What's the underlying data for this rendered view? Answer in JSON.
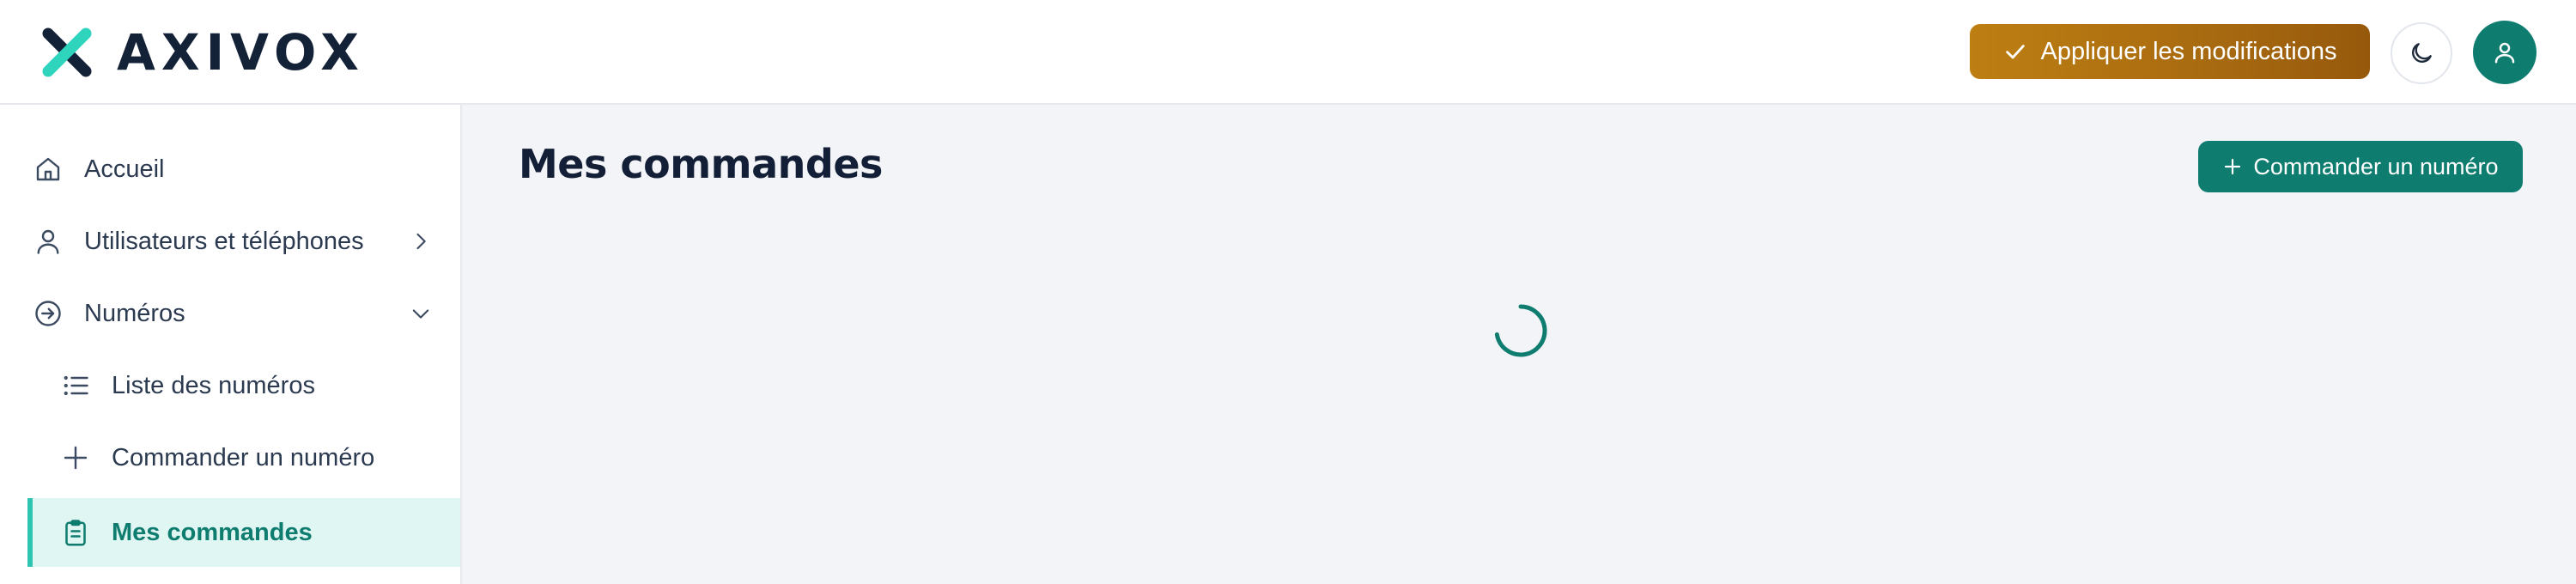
{
  "brand": {
    "name": "AXIVOX"
  },
  "header": {
    "apply_label": "Appliquer les modifications",
    "apply_icon": "check-icon",
    "theme_icon": "moon-icon",
    "user_icon": "user-icon",
    "colors": {
      "apply": "#a86a10",
      "accent": "#0e7c6f"
    }
  },
  "sidebar": {
    "items": [
      {
        "label": "Accueil",
        "icon": "home-icon"
      },
      {
        "label": "Utilisateurs et téléphones",
        "icon": "user-icon",
        "chevron": "chevron-right-icon"
      },
      {
        "label": "Numéros",
        "icon": "arrow-circle-right-icon",
        "chevron": "chevron-down-icon"
      },
      {
        "label": "Liste des numéros",
        "icon": "list-icon"
      },
      {
        "label": "Commander un numéro",
        "icon": "plus-icon"
      },
      {
        "label": "Mes commandes",
        "icon": "clipboard-icon",
        "active": true
      }
    ]
  },
  "main": {
    "title": "Mes commandes",
    "order_button_label": "Commander un numéro",
    "loading": true
  }
}
